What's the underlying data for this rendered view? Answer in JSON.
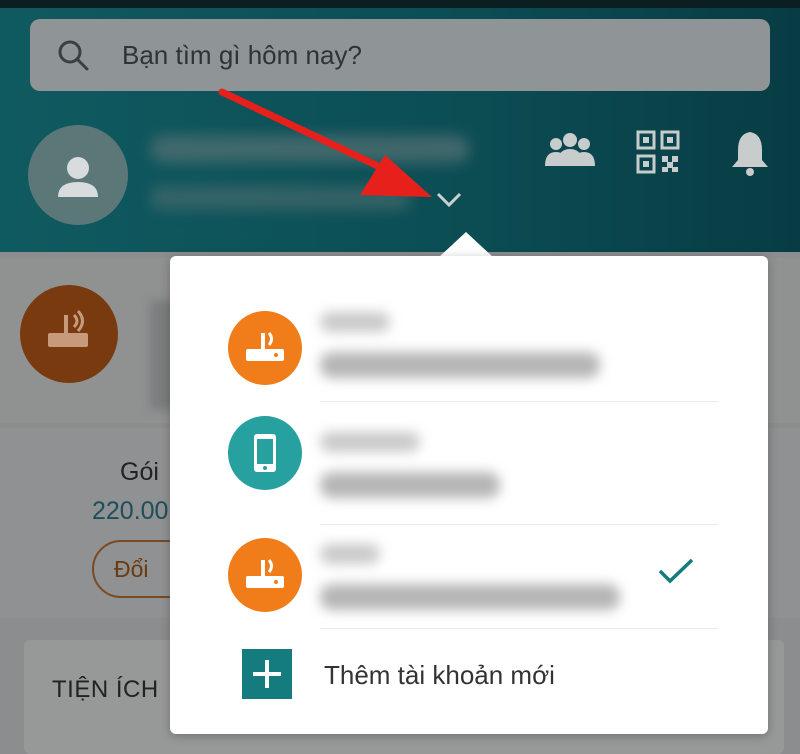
{
  "search": {
    "placeholder": "Bạn tìm gì hôm nay?"
  },
  "header": {
    "profile_icon": "person-icon",
    "menu_chevron_icon": "chevron-down-icon",
    "actions": [
      {
        "icon": "group-icon"
      },
      {
        "icon": "qr-code-icon"
      },
      {
        "icon": "bell-icon"
      }
    ]
  },
  "background": {
    "package_label": "Gói",
    "package_price": "220.00",
    "change_button_label": "Đổi",
    "utilities_label": "TIỆN ÍCH"
  },
  "account_menu": {
    "accounts": [
      {
        "type": "internet",
        "icon": "router-wifi-icon",
        "color": "#f07d1a",
        "selected": false
      },
      {
        "type": "mobile",
        "icon": "smartphone-icon",
        "color": "#27a1a0",
        "selected": false
      },
      {
        "type": "internet",
        "icon": "router-wifi-icon",
        "color": "#f07d1a",
        "selected": true
      }
    ],
    "selected_icon": "checkmark-icon",
    "add_account_label": "Thêm tài khoản mới",
    "add_icon": "plus-icon"
  },
  "colors": {
    "header_teal": "#0c4e55",
    "accent_teal": "#147b7e",
    "orange": "#f07d1a",
    "annotation_red": "#e8201c"
  }
}
